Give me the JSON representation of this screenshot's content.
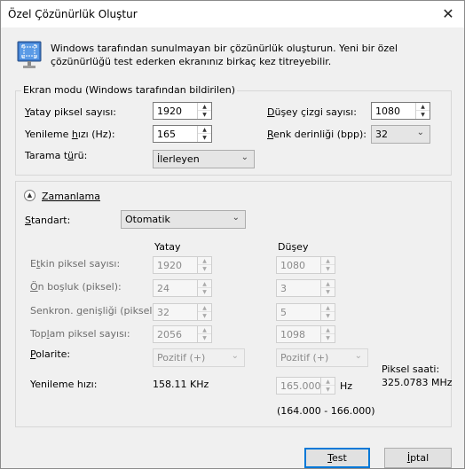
{
  "window": {
    "title": "Özel Çözünürlük Oluştur",
    "close_glyph": "✕"
  },
  "info_text": "Windows tarafından sunulmayan bir çözünürlük oluşturun. Yeni bir özel çözünürlüğü test ederken ekranınız birkaç kez titreyebilir.",
  "display_mode": {
    "group_title": "Ekran modu (Windows tarafından bildirilen)",
    "horizontal_pixels": {
      "label_u": "Y",
      "label_rest": "atay piksel sayısı:",
      "value": "1920"
    },
    "vertical_lines": {
      "label_u": "D",
      "label_rest": "üşey çizgi sayısı:",
      "value": "1080"
    },
    "refresh_rate": {
      "label_pre": "Yenileme ",
      "label_u": "h",
      "label_post": "ızı (Hz):",
      "value": "165"
    },
    "color_depth": {
      "label_u": "R",
      "label_rest": "enk derinliği (bpp):",
      "value": "32"
    },
    "scan_type": {
      "label_pre": "Tarama t",
      "label_u": "ü",
      "label_post": "rü:",
      "value": "İlerleyen"
    }
  },
  "timing": {
    "toggle_label": "Zamanlama",
    "standard_label_u": "S",
    "standard_label_rest": "tandart:",
    "standard_value": "Otomatik",
    "col_horizontal": "Yatay",
    "col_vertical": "Düşey",
    "rows": [
      {
        "label_pre": "E",
        "label_u": "t",
        "label_post": "kin piksel sayısı:",
        "h": "1920",
        "v": "1080"
      },
      {
        "label_pre": "",
        "label_u": "Ö",
        "label_post": "n boşluk (piksel):",
        "h": "24",
        "v": "3"
      },
      {
        "label_pre": "Senkron. ",
        "label_u": "g",
        "label_post": "enişliği (piksel):",
        "h": "32",
        "v": "5"
      },
      {
        "label_pre": "Top",
        "label_u": "l",
        "label_post": "am piksel sayısı:",
        "h": "2056",
        "v": "1098"
      }
    ],
    "polarity_label_u": "P",
    "polarity_label_rest": "olarite:",
    "polarity_h": "Pozitif (+)",
    "polarity_v": "Pozitif (+)",
    "refresh_label": "Yenileme hızı:",
    "refresh_h_value": "158.11 KHz",
    "refresh_v_value": "165.000",
    "refresh_v_unit": "Hz",
    "refresh_range": "(164.000 - 166.000)",
    "pixel_clock_label": "Piksel saati:",
    "pixel_clock_value": "325.0783 MHz"
  },
  "buttons": {
    "test_u": "T",
    "test_rest": "est",
    "cancel_u": "İ",
    "cancel_rest": "ptal"
  }
}
